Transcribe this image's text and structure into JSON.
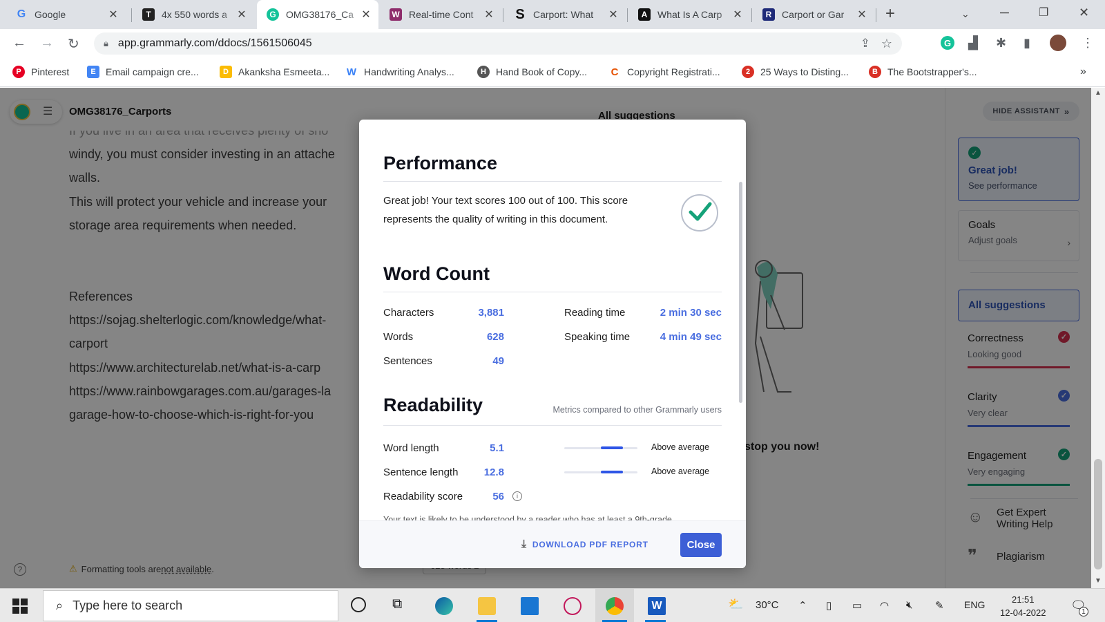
{
  "tabs": [
    {
      "title": "Google",
      "icon": "G"
    },
    {
      "title": "4x 550 words a",
      "icon": "T"
    },
    {
      "title": "OMG38176_Ca",
      "icon": "G"
    },
    {
      "title": "Real-time Cont",
      "icon": "W"
    },
    {
      "title": "Carport: What",
      "icon": "S"
    },
    {
      "title": "What Is A Carp",
      "icon": "A"
    },
    {
      "title": "Carport or Gar",
      "icon": "R"
    }
  ],
  "address": {
    "url": "app.grammarly.com/ddocs/1561506045"
  },
  "bookmarks": [
    {
      "label": "Pinterest",
      "icon": "P"
    },
    {
      "label": "Email campaign cre...",
      "icon": "E"
    },
    {
      "label": "Akanksha Esmeeta...",
      "icon": "D"
    },
    {
      "label": "Handwriting Analys...",
      "icon": "W"
    },
    {
      "label": "Hand Book of Copy...",
      "icon": "H"
    },
    {
      "label": "Copyright Registrati...",
      "icon": "C"
    },
    {
      "label": "25 Ways to Disting...",
      "icon": "2"
    },
    {
      "label": "The Bootstrapper's...",
      "icon": "B"
    }
  ],
  "doc": {
    "title": "OMG38176_Carports",
    "lines": [
      "If you live in an area that receives plenty of sno",
      "windy, you must consider investing in an attache",
      "walls.",
      "This will protect your vehicle and increase your",
      "storage area requirements when needed.",
      "References",
      "https://sojag.shelterlogic.com/knowledge/what-",
      "carport",
      "https://www.architecturelab.net/what-is-a-carp",
      "https://www.rainbowgarages.com.au/garages-la",
      "garage-how-to-choose-which-is-right-for-you"
    ],
    "all_suggestions_heading": "All suggestions",
    "stop_text": "stop you now!",
    "formatting_note_prefix": "Formatting tools are ",
    "formatting_note_link": "not available",
    "formatting_note_suffix": ".",
    "word_count_button": "628 words"
  },
  "sidebar": {
    "hide_assistant": "HIDE ASSISTANT",
    "great_job": {
      "title": "Great job!",
      "subtitle": "See performance"
    },
    "goals": {
      "title": "Goals",
      "subtitle": "Adjust goals"
    },
    "all_suggestions": "All suggestions",
    "metrics": [
      {
        "name": "Correctness",
        "status": "Looking good",
        "color": "#d6314f"
      },
      {
        "name": "Clarity",
        "status": "Very clear",
        "color": "#4a6ee0"
      },
      {
        "name": "Engagement",
        "status": "Very engaging",
        "color": "#15a279"
      }
    ],
    "expert_help": "Get Expert Writing Help",
    "plagiarism": "Plagiarism"
  },
  "modal": {
    "performance": {
      "heading": "Performance",
      "text": "Great job! Your text scores 100 out of 100. This score represents the quality of writing in this document."
    },
    "word_count": {
      "heading": "Word Count",
      "stats": [
        {
          "label": "Characters",
          "value": "3,881"
        },
        {
          "label": "Words",
          "value": "628"
        },
        {
          "label": "Sentences",
          "value": "49"
        }
      ],
      "times": [
        {
          "label": "Reading time",
          "value": "2 min 30 sec"
        },
        {
          "label": "Speaking time",
          "value": "4 min 49 sec"
        }
      ]
    },
    "readability": {
      "heading": "Readability",
      "comparison_note": "Metrics compared to other Grammarly users",
      "metrics": [
        {
          "label": "Word length",
          "value": "5.1",
          "rating": "Above average",
          "bar_fraction": 0.8
        },
        {
          "label": "Sentence length",
          "value": "12.8",
          "rating": "Above average",
          "bar_fraction": 0.8
        }
      ],
      "score": {
        "label": "Readability score",
        "value": "56"
      },
      "cut_text": "Your text is likely to be understood by a reader who has at least a 9th-grade"
    },
    "download_label": "DOWNLOAD PDF REPORT",
    "close_label": "Close"
  },
  "taskbar": {
    "search_placeholder": "Type here to search",
    "weather": "30°C",
    "language": "ENG",
    "time": "21:51",
    "date": "12-04-2022",
    "notification_count": "1"
  },
  "colors": {
    "accent": "#4a6ee0",
    "success": "#15a279",
    "error": "#d6314f"
  }
}
